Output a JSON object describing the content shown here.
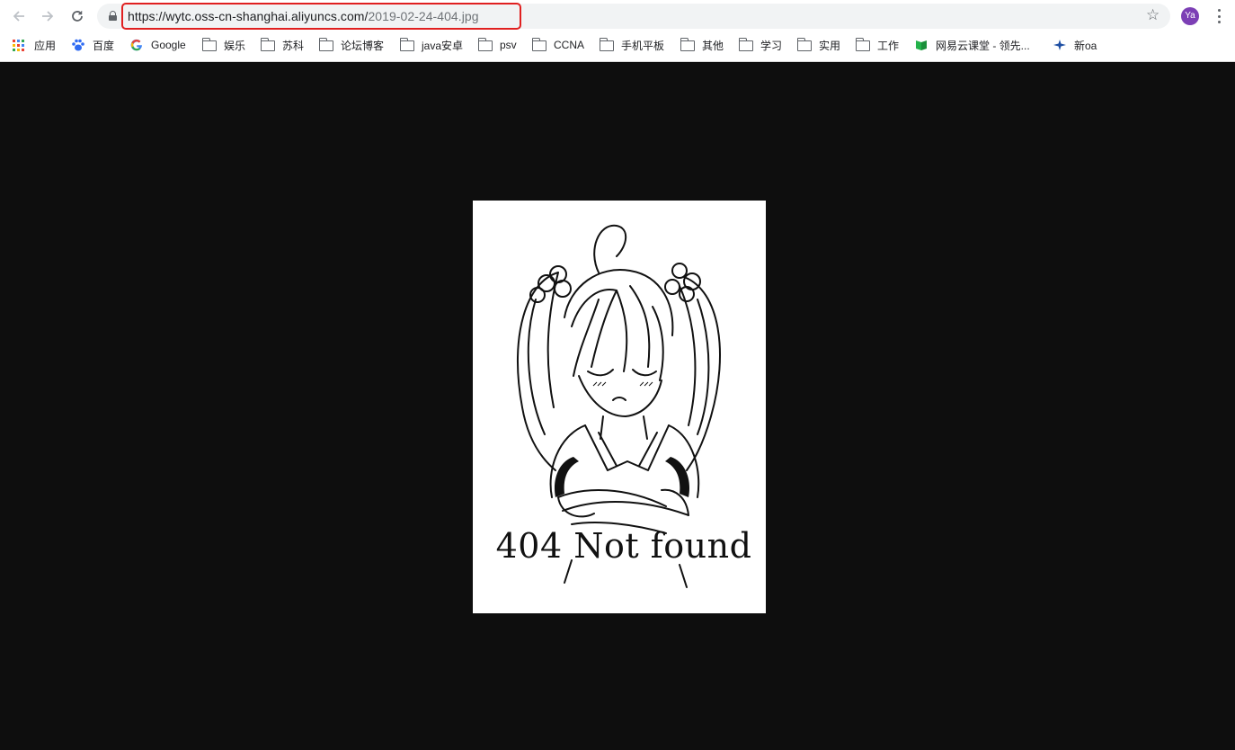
{
  "browser": {
    "url_host": "https://wytc.oss-cn-shanghai.aliyuncs.com/",
    "url_path": "2019-02-24-404.jpg",
    "profile_initials": "Ya",
    "icons": {
      "back": "arrow-left",
      "forward": "arrow-right",
      "reload": "refresh",
      "secure": "lock",
      "bookmark": "star-outline",
      "menu": "vertical-dots"
    }
  },
  "bookmarks": [
    {
      "label": "应用",
      "icon": "apps-grid-icon"
    },
    {
      "label": "百度",
      "icon": "paw-icon"
    },
    {
      "label": "Google",
      "icon": "google-icon"
    },
    {
      "label": "娱乐",
      "icon": "folder-icon"
    },
    {
      "label": "苏科",
      "icon": "folder-icon"
    },
    {
      "label": "论坛博客",
      "icon": "folder-icon"
    },
    {
      "label": "java安卓",
      "icon": "folder-icon"
    },
    {
      "label": "psv",
      "icon": "folder-icon"
    },
    {
      "label": "CCNA",
      "icon": "folder-icon"
    },
    {
      "label": "手机平板",
      "icon": "folder-icon"
    },
    {
      "label": "其他",
      "icon": "folder-icon"
    },
    {
      "label": "学习",
      "icon": "folder-icon"
    },
    {
      "label": "实用",
      "icon": "folder-icon"
    },
    {
      "label": "工作",
      "icon": "folder-icon"
    },
    {
      "label": "网易云课堂 - 领先...",
      "icon": "book-icon"
    },
    {
      "label": "新oa",
      "icon": "plane-icon"
    }
  ],
  "bookmarks_overflow": "»",
  "image": {
    "caption": "404 Not found"
  },
  "colors": {
    "highlight": "#e02020",
    "viewer_background": "#0e0e0e",
    "avatar": "#7c3fb5"
  }
}
